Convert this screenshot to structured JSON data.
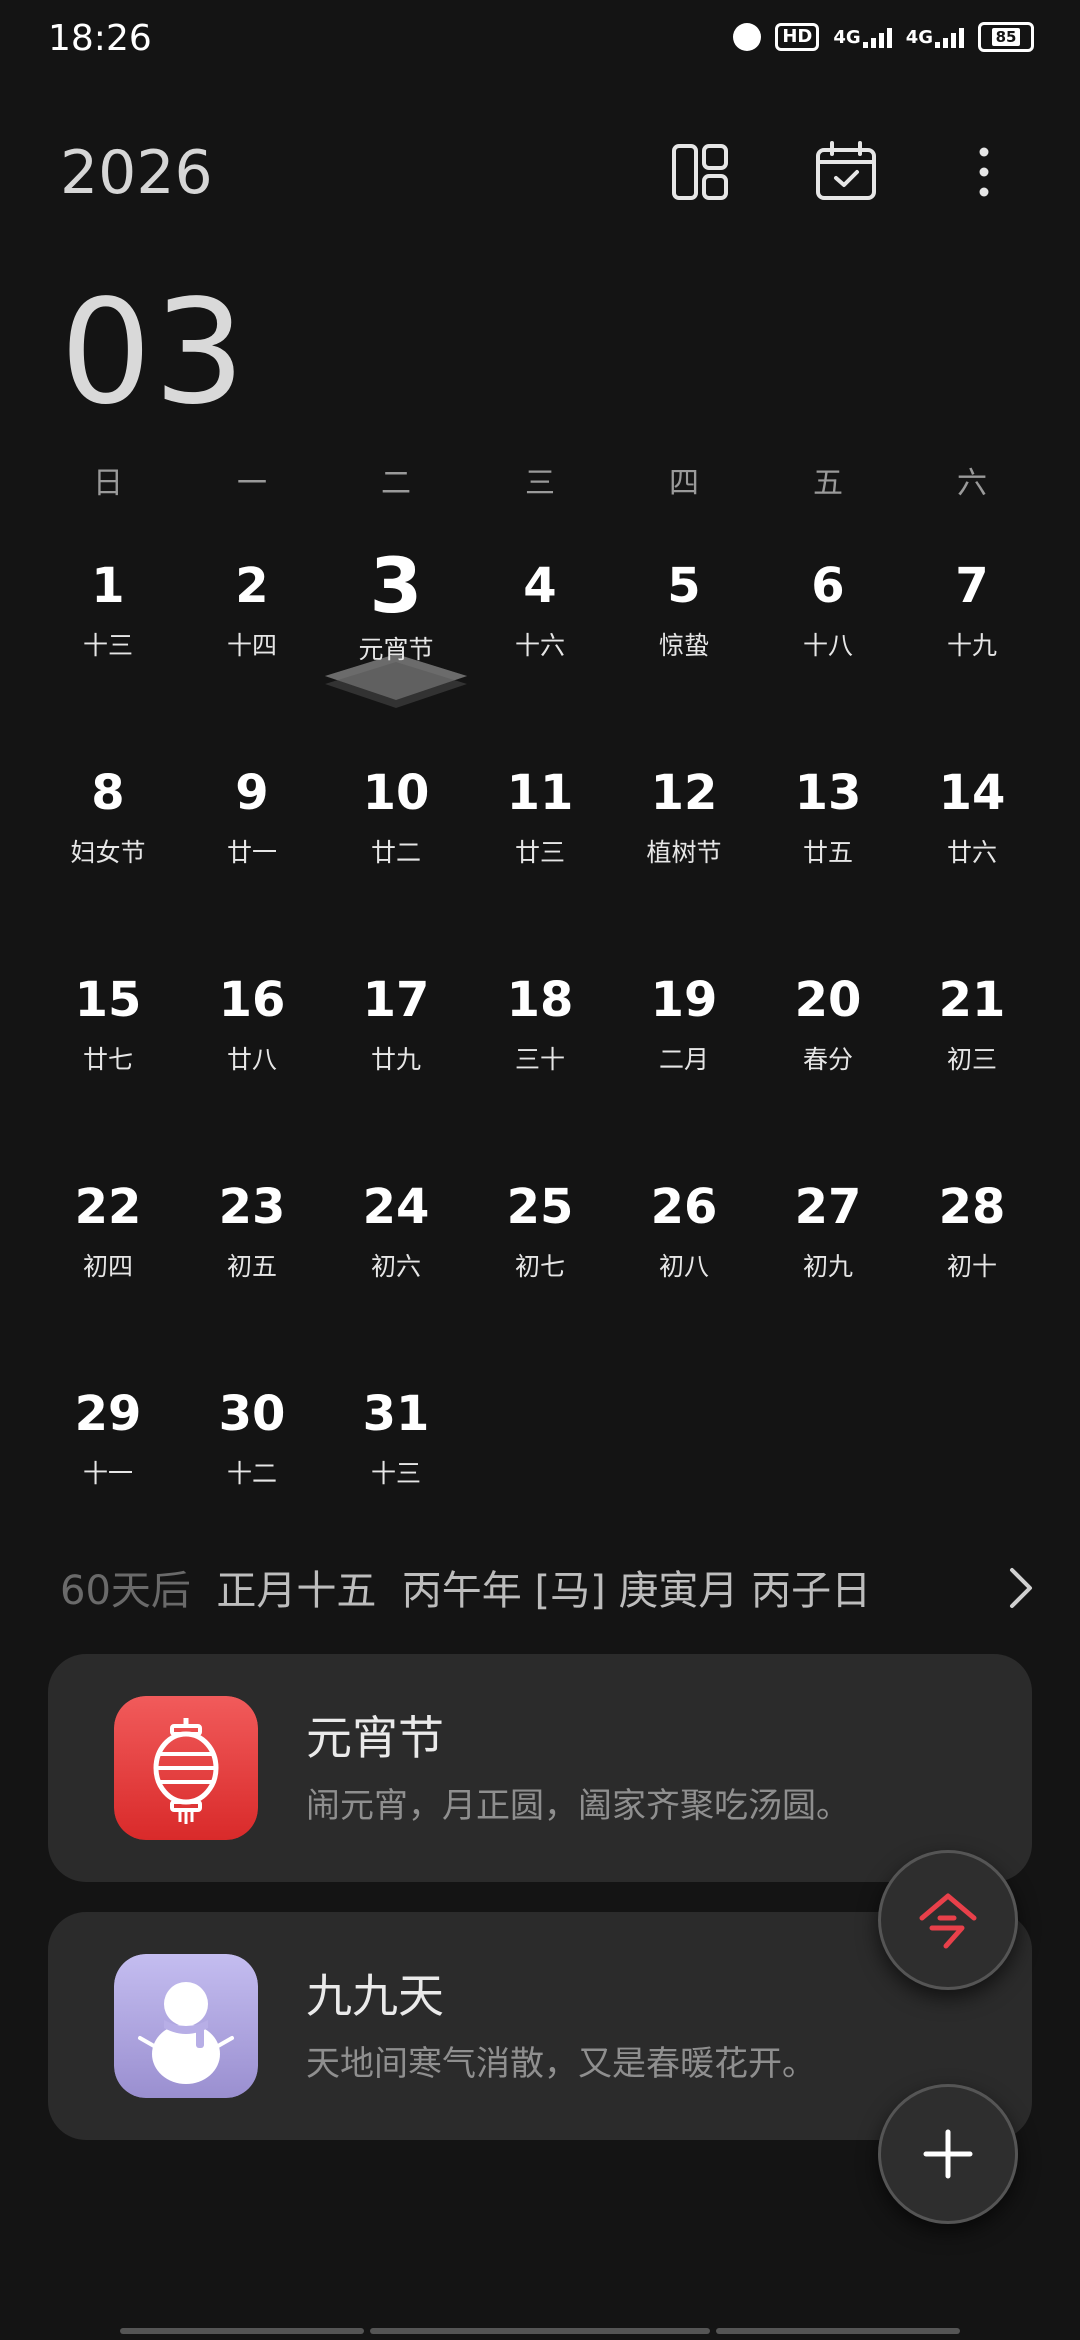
{
  "status_bar": {
    "time": "18:26",
    "hd_label": "HD",
    "sim1_label": "4G",
    "sim2_label": "4G",
    "battery": "85"
  },
  "header": {
    "year": "2026",
    "month": "03",
    "icons": [
      "layout-view-icon",
      "calendar-today-check-icon",
      "more-vertical-icon"
    ]
  },
  "calendar": {
    "weekdays": [
      "日",
      "一",
      "二",
      "三",
      "四",
      "五",
      "六"
    ],
    "selected_day": "3",
    "days": [
      {
        "day": "1",
        "lunar": "十三"
      },
      {
        "day": "2",
        "lunar": "十四"
      },
      {
        "day": "3",
        "lunar": "元宵节"
      },
      {
        "day": "4",
        "lunar": "十六"
      },
      {
        "day": "5",
        "lunar": "惊蛰"
      },
      {
        "day": "6",
        "lunar": "十八"
      },
      {
        "day": "7",
        "lunar": "十九"
      },
      {
        "day": "8",
        "lunar": "妇女节"
      },
      {
        "day": "9",
        "lunar": "廿一"
      },
      {
        "day": "10",
        "lunar": "廿二"
      },
      {
        "day": "11",
        "lunar": "廿三"
      },
      {
        "day": "12",
        "lunar": "植树节"
      },
      {
        "day": "13",
        "lunar": "廿五"
      },
      {
        "day": "14",
        "lunar": "廿六"
      },
      {
        "day": "15",
        "lunar": "廿七"
      },
      {
        "day": "16",
        "lunar": "廿八"
      },
      {
        "day": "17",
        "lunar": "廿九"
      },
      {
        "day": "18",
        "lunar": "三十"
      },
      {
        "day": "19",
        "lunar": "二月"
      },
      {
        "day": "20",
        "lunar": "春分"
      },
      {
        "day": "21",
        "lunar": "初三"
      },
      {
        "day": "22",
        "lunar": "初四"
      },
      {
        "day": "23",
        "lunar": "初五"
      },
      {
        "day": "24",
        "lunar": "初六"
      },
      {
        "day": "25",
        "lunar": "初七"
      },
      {
        "day": "26",
        "lunar": "初八"
      },
      {
        "day": "27",
        "lunar": "初九"
      },
      {
        "day": "28",
        "lunar": "初十"
      },
      {
        "day": "29",
        "lunar": "十一"
      },
      {
        "day": "30",
        "lunar": "十二"
      },
      {
        "day": "31",
        "lunar": "十三"
      }
    ]
  },
  "info": {
    "days_after": "60天后",
    "lunar_date": "正月十五",
    "year_ganzhi": "丙午年",
    "zodiac": "[马]",
    "month_ganzhi": "庚寅月",
    "day_ganzhi": "丙子日"
  },
  "events": [
    {
      "title": "元宵节",
      "desc": "闹元宵，月正圆，阖家齐聚吃汤圆。",
      "icon": "lantern-icon",
      "color": "#e53935"
    },
    {
      "title": "九九天",
      "desc": "天地间寒气消散，又是春暖花开。",
      "icon": "snowman-icon",
      "color": "#a89ed8"
    }
  ],
  "fab": {
    "today_label": "今",
    "today_color": "#e8404a"
  }
}
